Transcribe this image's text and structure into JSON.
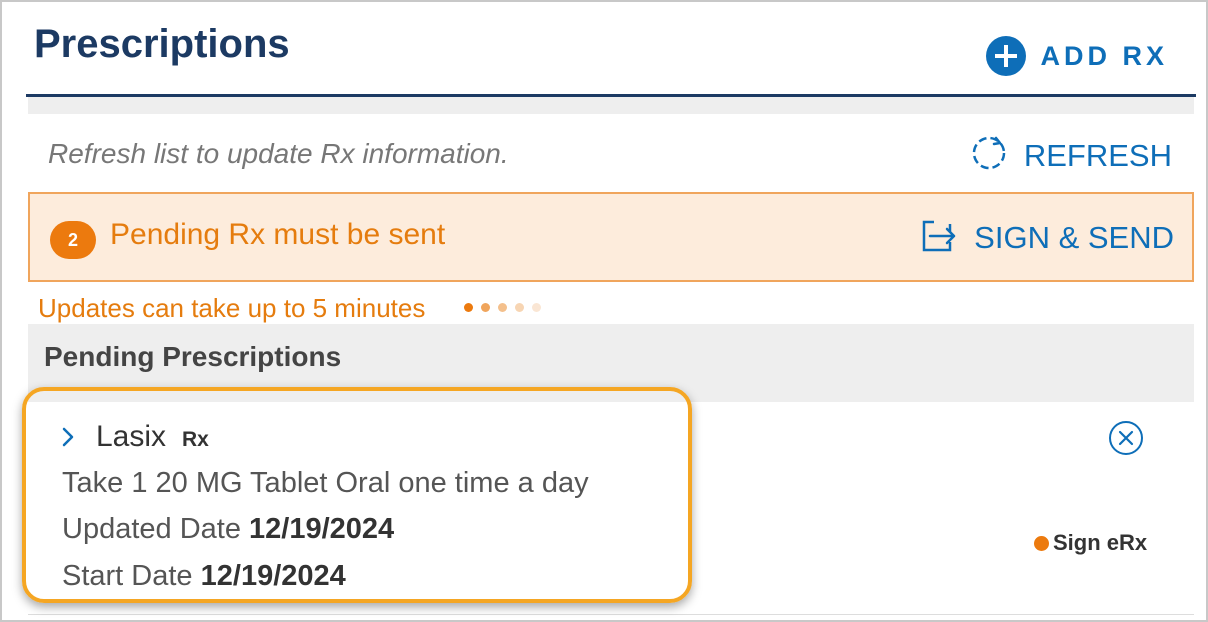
{
  "header": {
    "title": "Prescriptions",
    "add_rx_label": "ADD RX"
  },
  "refresh_bar": {
    "hint": "Refresh list to update Rx information.",
    "refresh_label": "REFRESH"
  },
  "pending_banner": {
    "count": "2",
    "message": "Pending Rx must be sent",
    "sign_send_label": "SIGN & SEND"
  },
  "updates_note": "Updates can take up to 5 minutes",
  "section": {
    "title": "Pending Prescriptions"
  },
  "prescription": {
    "drug_name": "Lasix",
    "rx_tag": "Rx",
    "instructions": "Take 1 20 MG Tablet Oral one time a day",
    "updated_label": "Updated Date",
    "updated_value": "12/19/2024",
    "start_label": "Start Date",
    "start_value": "12/19/2024",
    "status": "Sign eRx"
  },
  "icons": {
    "add": "plus-circle-icon",
    "refresh": "refresh-dashed-circle-icon",
    "sign_send": "export-arrow-icon",
    "expand": "chevron-right-icon",
    "remove": "close-circle-icon",
    "status": "status-dot-icon"
  },
  "colors": {
    "primary": "#0e6eb8",
    "navy": "#1c3a63",
    "accent_orange": "#ec7a0e",
    "banner_bg": "#fdecdc",
    "highlight": "#f5a623"
  }
}
